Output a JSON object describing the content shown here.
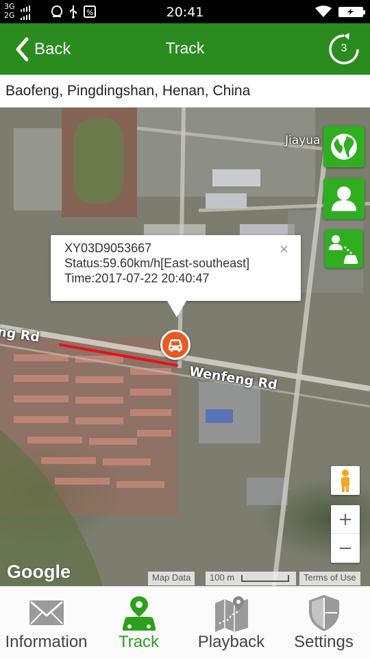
{
  "status_bar": {
    "network": "3G\n2G",
    "time": "20:41"
  },
  "header": {
    "back_label": "Back",
    "title": "Track",
    "refresh_count": "3"
  },
  "address": "Baofeng, Pingdingshan, Henan, China",
  "map": {
    "road_labels": [
      "Wenfeng Rd",
      "ng Rd",
      "Jiayua"
    ],
    "popup": {
      "device_id": "XY03D9053667",
      "status": "Status:59.60km/h[East-southeast]",
      "time": "Time:2017-07-22 20:40:47",
      "close": "×"
    },
    "controls": {
      "zoom_in": "+",
      "zoom_out": "−"
    },
    "google": "Google",
    "map_data": "Map Data",
    "scale": "100 m",
    "terms": "Terms of Use"
  },
  "bottom_nav": [
    {
      "label": "Information",
      "icon": "envelope-icon",
      "active": false
    },
    {
      "label": "Track",
      "icon": "car-location-icon",
      "active": true
    },
    {
      "label": "Playback",
      "icon": "map-route-icon",
      "active": false
    },
    {
      "label": "Settings",
      "icon": "shield-icon",
      "active": false
    }
  ],
  "colors": {
    "header": "#2a8c1e",
    "accent": "#2aa01b",
    "side_buttons": "#2fae1f",
    "track_line": "#e8101a",
    "marker": "#e85a1f"
  }
}
